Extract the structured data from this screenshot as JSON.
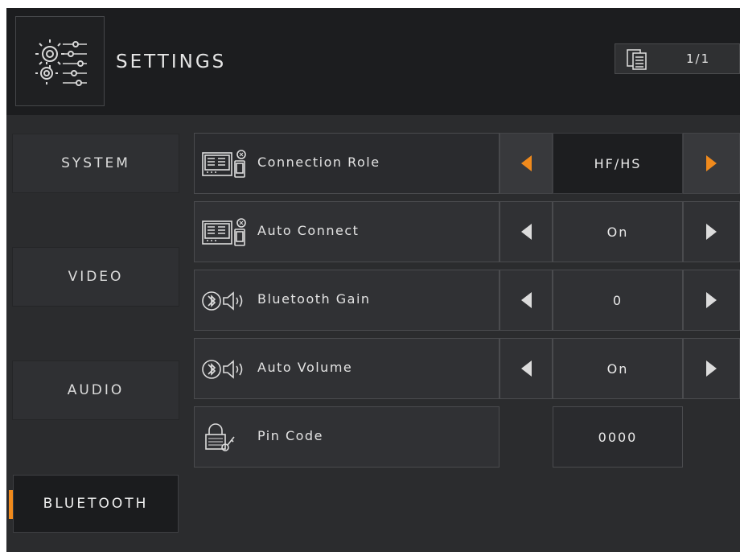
{
  "header": {
    "title": "SETTINGS",
    "page_indicator": "1/1"
  },
  "sidebar": {
    "items": [
      {
        "label": "SYSTEM",
        "active": false
      },
      {
        "label": "VIDEO",
        "active": false
      },
      {
        "label": "AUDIO",
        "active": false
      },
      {
        "label": "BLUETOOTH",
        "active": true
      }
    ]
  },
  "settings": {
    "rows": [
      {
        "label": "Connection Role",
        "value": "HF/HS",
        "icon": "device-phone-icon",
        "selected": true
      },
      {
        "label": "Auto Connect",
        "value": "On",
        "icon": "device-phone-icon",
        "selected": false
      },
      {
        "label": "Bluetooth Gain",
        "value": "0",
        "icon": "bluetooth-speaker-icon",
        "selected": false
      },
      {
        "label": "Auto Volume",
        "value": "On",
        "icon": "bluetooth-speaker-icon",
        "selected": false
      },
      {
        "label": "Pin Code",
        "value": "0000",
        "icon": "lock-key-icon",
        "selected": false
      }
    ]
  },
  "colors": {
    "accent": "#f08a1c",
    "background": "#2b2c2e",
    "header_background": "#1c1d1f",
    "text": "#e3e3e3"
  }
}
